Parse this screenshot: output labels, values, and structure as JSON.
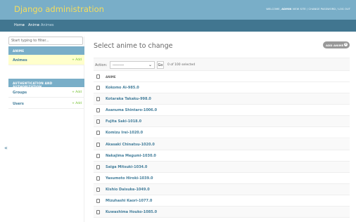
{
  "header": {
    "title": "Django administration",
    "welcome": "WELCOME,",
    "username": "ADMIN",
    "links": "VIEW SITE / CHANGE PASSWORD / LOG OUT"
  },
  "breadcrumbs": {
    "home": "Home",
    "sep": "›",
    "app": "Anime",
    "model": "Animes"
  },
  "sidebar": {
    "filter_placeholder": "Start typing to filter...",
    "sections": [
      {
        "caption": "ANIME",
        "items": [
          {
            "label": "Animes",
            "add": "+ Add"
          }
        ]
      },
      {
        "caption": "AUTHENTICATION AND AUTHORIZATION",
        "items": [
          {
            "label": "Groups",
            "add": "+ Add"
          },
          {
            "label": "Users",
            "add": "+ Add"
          }
        ]
      }
    ],
    "collapse": "«"
  },
  "content": {
    "title": "Select anime to change",
    "add_button": "ADD ANIME",
    "action_label": "Action:",
    "action_selected": "---------",
    "go": "Go",
    "selection_count": "0 of 100 selected",
    "column_header": "ANIME",
    "rows": [
      "Kokomo Ai-985.0",
      "Kotaraka Takaku-998.0",
      "Asanuma Shintaro-1006.0",
      "Fujita Saki-1018.0",
      "Komizu Irei-1020.0",
      "Akasaki Chinatsu-1020.0",
      "Nakajima Megumi-1030.0",
      "Saiga Mitsuki-1034.0",
      "Yasumoto Hiroki-1039.0",
      "Kishio Daisuke-1049.0",
      "Mizuhashi Kaori-1077.0",
      "Kuwashima Houko-1085.0"
    ]
  }
}
